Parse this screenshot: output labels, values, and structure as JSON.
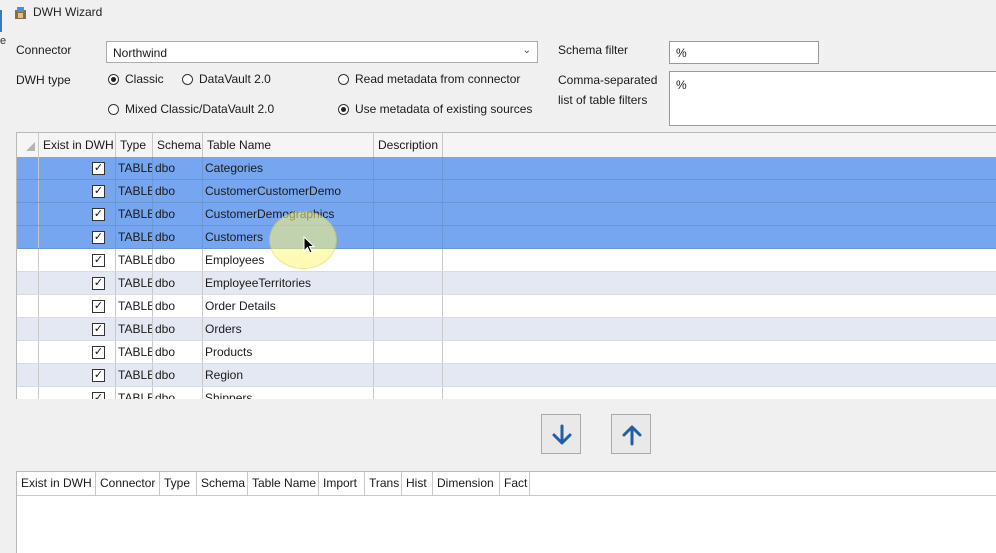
{
  "window": {
    "title": "DWH Wizard",
    "edge_fragment": "e"
  },
  "form": {
    "connector_label": "Connector",
    "connector_value": "Northwind",
    "dwh_type_label": "DWH type",
    "schema_filter_label": "Schema filter",
    "schema_filter_value": "%",
    "table_filters_label_line1": "Comma-separated",
    "table_filters_label_line2": "list of table filters",
    "table_filters_value": "%",
    "radios": {
      "classic": {
        "label": "Classic",
        "selected": true
      },
      "datavault": {
        "label": "DataVault 2.0",
        "selected": false
      },
      "mixed": {
        "label": "Mixed Classic/DataVault 2.0",
        "selected": false
      },
      "read_meta": {
        "label": "Read metadata from connector",
        "selected": false
      },
      "use_meta": {
        "label": "Use metadata of existing sources",
        "selected": true
      }
    }
  },
  "source_grid": {
    "columns": [
      "Exist in DWH",
      "Type",
      "Schema",
      "Table Name",
      "Description"
    ],
    "rows": [
      {
        "exist": true,
        "type": "TABLE",
        "schema": "dbo",
        "name": "Categories",
        "description": "",
        "selected": true
      },
      {
        "exist": true,
        "type": "TABLE",
        "schema": "dbo",
        "name": "CustomerCustomerDemo",
        "description": "",
        "selected": true
      },
      {
        "exist": true,
        "type": "TABLE",
        "schema": "dbo",
        "name": "CustomerDemographics",
        "description": "",
        "selected": true
      },
      {
        "exist": true,
        "type": "TABLE",
        "schema": "dbo",
        "name": "Customers",
        "description": "",
        "selected": true
      },
      {
        "exist": true,
        "type": "TABLE",
        "schema": "dbo",
        "name": "Employees",
        "description": "",
        "selected": false
      },
      {
        "exist": true,
        "type": "TABLE",
        "schema": "dbo",
        "name": "EmployeeTerritories",
        "description": "",
        "selected": false
      },
      {
        "exist": true,
        "type": "TABLE",
        "schema": "dbo",
        "name": "Order Details",
        "description": "",
        "selected": false
      },
      {
        "exist": true,
        "type": "TABLE",
        "schema": "dbo",
        "name": "Orders",
        "description": "",
        "selected": false
      },
      {
        "exist": true,
        "type": "TABLE",
        "schema": "dbo",
        "name": "Products",
        "description": "",
        "selected": false
      },
      {
        "exist": true,
        "type": "TABLE",
        "schema": "dbo",
        "name": "Region",
        "description": "",
        "selected": false
      },
      {
        "exist": true,
        "type": "TABLE",
        "schema": "dbo",
        "name": "Shippers",
        "description": "",
        "selected": false
      }
    ]
  },
  "buttons": {
    "move_down_icon": "arrow-down-icon",
    "move_up_icon": "arrow-up-icon",
    "accent": "#1f5fa8"
  },
  "target_grid": {
    "columns": [
      "Exist in DWH",
      "Connector",
      "Type",
      "Schema",
      "Table Name",
      "Import",
      "Trans",
      "Hist",
      "Dimension",
      "Fact"
    ]
  }
}
